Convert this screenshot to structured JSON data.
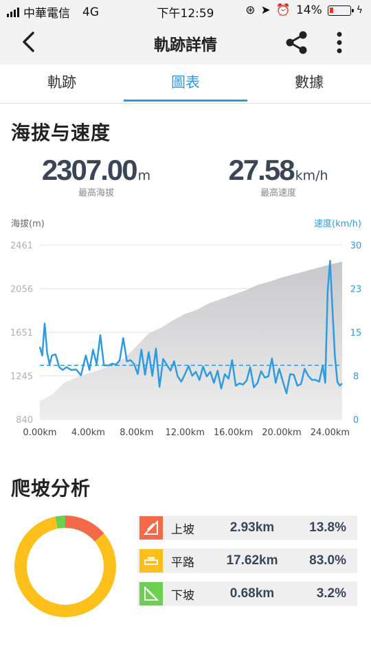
{
  "status": {
    "carrier": "中華電信",
    "network": "4G",
    "time": "下午12:59",
    "battery": "14%"
  },
  "nav": {
    "title": "軌跡詳情"
  },
  "tabs": [
    {
      "label": "軌跡",
      "active": false
    },
    {
      "label": "圖表",
      "active": true
    },
    {
      "label": "數據",
      "active": false
    }
  ],
  "section1": {
    "title": "海拔与速度",
    "max_alt": {
      "value": "2307.00",
      "unit": "m",
      "label": "最高海拔"
    },
    "max_speed": {
      "value": "27.58",
      "unit": "km/h",
      "label": "最高速度"
    }
  },
  "chart_data": {
    "type": "area",
    "y_left_label": "海拔(m)",
    "y_right_label": "速度(km/h)",
    "y_left_ticks": [
      "2461",
      "2056",
      "1651",
      "1245",
      "840"
    ],
    "y_right_ticks": [
      "30",
      "23",
      "15",
      "8",
      "0"
    ],
    "x_ticks": [
      "0.00km",
      "4.00km",
      "8.00km",
      "12.00km",
      "16.00km",
      "20.00km",
      "24.00km"
    ],
    "xlim": [
      0,
      25
    ],
    "ylim_left": [
      840,
      2461
    ],
    "ylim_right": [
      0,
      30
    ],
    "avg_speed": 9.3,
    "altitude": {
      "x": [
        0,
        1,
        2,
        3,
        4,
        5,
        6,
        7,
        8,
        9,
        10,
        11,
        12,
        13,
        14,
        15,
        16,
        17,
        18,
        19,
        20,
        21,
        22,
        23,
        24,
        25
      ],
      "y": [
        1010,
        1070,
        1180,
        1230,
        1270,
        1300,
        1350,
        1410,
        1520,
        1640,
        1690,
        1760,
        1820,
        1860,
        1920,
        1960,
        2000,
        2040,
        2090,
        2120,
        2160,
        2190,
        2220,
        2250,
        2280,
        2307
      ]
    },
    "speed": {
      "x": [
        0,
        0.2,
        0.4,
        0.6,
        0.8,
        1,
        1.3,
        1.6,
        1.9,
        2.2,
        2.6,
        3,
        3.4,
        3.8,
        4.1,
        4.4,
        4.7,
        5,
        5.3,
        5.7,
        6,
        6.3,
        6.6,
        6.9,
        7.2,
        7.5,
        7.8,
        8.1,
        8.4,
        8.7,
        9,
        9.3,
        9.6,
        9.9,
        10.2,
        10.5,
        10.8,
        11.1,
        11.4,
        11.7,
        12,
        12.3,
        12.6,
        12.9,
        13.2,
        13.5,
        13.8,
        14.1,
        14.4,
        14.7,
        15,
        15.3,
        15.6,
        15.9,
        16.2,
        16.5,
        16.8,
        17.1,
        17.4,
        17.7,
        18,
        18.3,
        18.6,
        18.9,
        19.2,
        19.5,
        19.8,
        20.1,
        20.4,
        20.7,
        21,
        21.3,
        21.6,
        21.9,
        22.2,
        22.5,
        22.8,
        23.1,
        23.4,
        23.6,
        23.8,
        24,
        24.2,
        24.4,
        24.6,
        24.8,
        25
      ],
      "y": [
        12.5,
        11,
        16.5,
        11.5,
        9.5,
        11,
        11.2,
        9,
        8.5,
        9,
        8.5,
        8.6,
        7.6,
        11,
        8.5,
        12,
        9.5,
        14.5,
        9.3,
        9.3,
        9.6,
        9.4,
        10.2,
        14,
        10,
        10.2,
        9.5,
        7.8,
        12,
        7.7,
        11.6,
        7.5,
        12.2,
        5.6,
        10.4,
        9.4,
        8.4,
        10,
        7.4,
        6.5,
        7.8,
        9.2,
        7.5,
        8.2,
        6.8,
        9.1,
        7.4,
        8.2,
        6.3,
        8.4,
        5.3,
        7.8,
        7,
        10.2,
        5.8,
        6.2,
        6,
        6.7,
        9,
        5.5,
        6.3,
        8.3,
        7.2,
        7.4,
        10.5,
        6.3,
        8.7,
        6.5,
        4.5,
        7.8,
        7.7,
        5.8,
        6.1,
        8.7,
        7.5,
        6.8,
        6.8,
        6.5,
        9.3,
        6.3,
        22,
        27.3,
        19,
        11,
        6.5,
        5.8,
        6.2
      ]
    }
  },
  "section2": {
    "title": "爬坡分析",
    "rows": [
      {
        "name": "上坡",
        "dist": "2.93km",
        "pct": "13.8%",
        "color": "#f26a4a",
        "icon": "uphill-icon",
        "share": 13.8
      },
      {
        "name": "平路",
        "dist": "17.62km",
        "pct": "83.0%",
        "color": "#fdbf1a",
        "icon": "flat-road-icon",
        "share": 83.0
      },
      {
        "name": "下坡",
        "dist": "0.68km",
        "pct": "3.2%",
        "color": "#6ccf4f",
        "icon": "downhill-icon",
        "share": 3.2
      }
    ]
  }
}
